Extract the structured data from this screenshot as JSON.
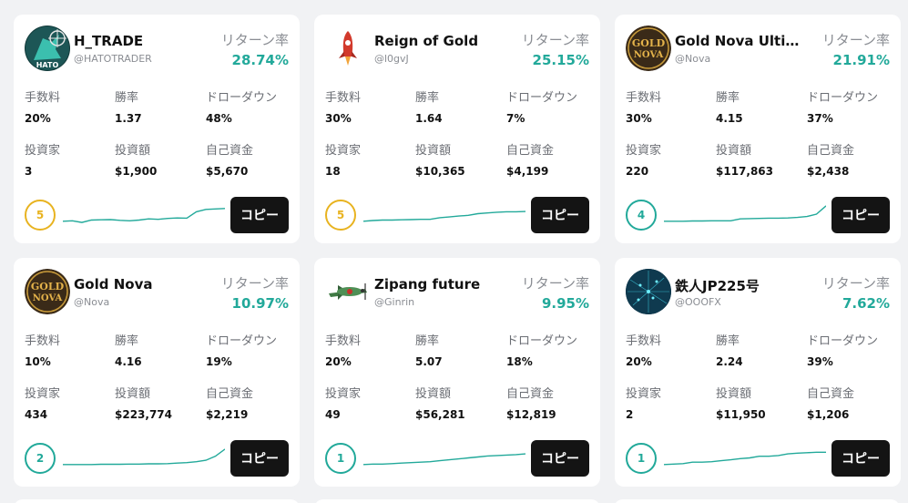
{
  "labels": {
    "return": "リターン率",
    "fee": "手数料",
    "winrate": "勝率",
    "drawdown": "ドローダウン",
    "investors": "投資家",
    "amount": "投資額",
    "own": "自己資金",
    "copy": "コピー"
  },
  "colors": {
    "accent": "#22a99a",
    "rank_gold": "#e8b320",
    "button": "#141414"
  },
  "cards": [
    {
      "name": "H_TRADE",
      "handle": "@HATOTRADER",
      "return_value": "28.74%",
      "fee": "20%",
      "winrate": "1.37",
      "drawdown": "48%",
      "investors": "3",
      "amount": "$1,900",
      "own": "$5,670",
      "rank": "5",
      "rank_style": "gold",
      "avatar_icon": "hawk-avatar-icon",
      "avatar_text": "HATO",
      "spark": [
        0.2,
        0.22,
        0.15,
        0.25,
        0.26,
        0.27,
        0.24,
        0.22,
        0.25,
        0.3,
        0.28,
        0.32,
        0.34,
        0.33,
        0.6,
        0.7,
        0.72,
        0.74
      ]
    },
    {
      "name": "Reign of Gold",
      "handle": "@l0gvJ",
      "return_value": "25.15%",
      "fee": "30%",
      "winrate": "1.64",
      "drawdown": "7%",
      "investors": "18",
      "amount": "$10,365",
      "own": "$4,199",
      "rank": "5",
      "rank_style": "gold",
      "avatar_icon": "rocket-avatar-icon",
      "avatar_text": "",
      "spark": [
        0.2,
        0.23,
        0.25,
        0.25,
        0.26,
        0.27,
        0.28,
        0.28,
        0.35,
        0.38,
        0.42,
        0.45,
        0.52,
        0.55,
        0.58,
        0.6,
        0.6,
        0.61
      ]
    },
    {
      "name": "Gold Nova Ultimate",
      "handle": "@Nova",
      "return_value": "21.91%",
      "fee": "30%",
      "winrate": "4.15",
      "drawdown": "37%",
      "investors": "220",
      "amount": "$117,863",
      "own": "$2,438",
      "rank": "4",
      "rank_style": "teal",
      "avatar_icon": "gold-nova-logo-icon",
      "avatar_text": "GOLD NOVA",
      "spark": [
        0.2,
        0.2,
        0.2,
        0.21,
        0.21,
        0.22,
        0.22,
        0.22,
        0.3,
        0.31,
        0.32,
        0.33,
        0.33,
        0.34,
        0.36,
        0.4,
        0.5,
        0.85
      ]
    },
    {
      "name": "Gold Nova",
      "handle": "@Nova",
      "return_value": "10.97%",
      "fee": "10%",
      "winrate": "4.16",
      "drawdown": "19%",
      "investors": "434",
      "amount": "$223,774",
      "own": "$2,219",
      "rank": "2",
      "rank_style": "teal",
      "avatar_icon": "gold-nova-logo-icon",
      "avatar_text": "GOLD NOVA",
      "spark": [
        0.2,
        0.2,
        0.2,
        0.2,
        0.21,
        0.21,
        0.21,
        0.22,
        0.22,
        0.23,
        0.23,
        0.24,
        0.26,
        0.28,
        0.32,
        0.38,
        0.55,
        0.85
      ]
    },
    {
      "name": "Zipang future",
      "handle": "@Ginrin",
      "return_value": "9.95%",
      "fee": "20%",
      "winrate": "5.07",
      "drawdown": "18%",
      "investors": "49",
      "amount": "$56,281",
      "own": "$12,819",
      "rank": "1",
      "rank_style": "teal",
      "avatar_icon": "fighter-plane-avatar-icon",
      "avatar_text": "",
      "spark": [
        0.2,
        0.22,
        0.22,
        0.24,
        0.26,
        0.28,
        0.3,
        0.32,
        0.36,
        0.4,
        0.44,
        0.48,
        0.52,
        0.56,
        0.58,
        0.6,
        0.62,
        0.65
      ]
    },
    {
      "name": "鉄人JP225号",
      "handle": "@OOOFX",
      "return_value": "7.62%",
      "fee": "20%",
      "winrate": "2.24",
      "drawdown": "39%",
      "investors": "2",
      "amount": "$11,950",
      "own": "$1,206",
      "rank": "1",
      "rank_style": "teal",
      "avatar_icon": "data-network-avatar-icon",
      "avatar_text": "",
      "spark": [
        0.2,
        0.22,
        0.24,
        0.3,
        0.3,
        0.32,
        0.36,
        0.4,
        0.45,
        0.48,
        0.55,
        0.55,
        0.58,
        0.65,
        0.68,
        0.7,
        0.72,
        0.72
      ]
    }
  ]
}
